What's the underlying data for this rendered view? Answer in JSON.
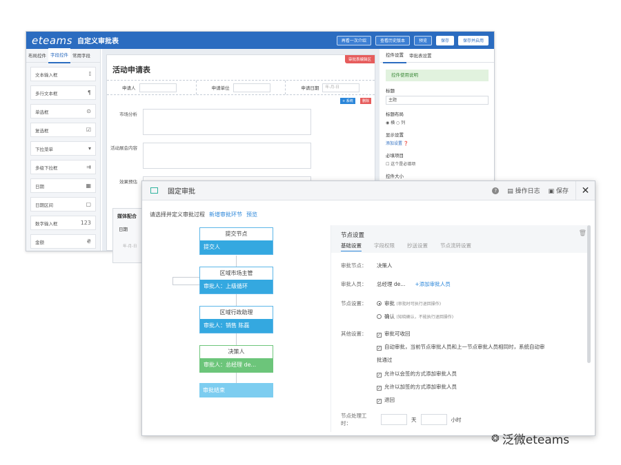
{
  "back": {
    "logo": "eteams",
    "title": "自定义审批表",
    "buttons": [
      "再看一次介绍",
      "查看历史版本",
      "预览",
      "保存",
      "保存并启用"
    ],
    "left_tabs": [
      "布局控件",
      "字段控件",
      "常用字段"
    ],
    "controls": [
      {
        "label": "文本输入框",
        "icon": "𝕀"
      },
      {
        "label": "多行文本框",
        "icon": "¶"
      },
      {
        "label": "单选框",
        "icon": "⊙"
      },
      {
        "label": "复选框",
        "icon": "☑"
      },
      {
        "label": "下拉菜单",
        "icon": "▾"
      },
      {
        "label": "多级下拉框",
        "icon": "⇉"
      },
      {
        "label": "日期",
        "icon": "▦"
      },
      {
        "label": "日期区间",
        "icon": "▢"
      },
      {
        "label": "数字输入框",
        "icon": "123"
      },
      {
        "label": "金额",
        "icon": "₴"
      }
    ],
    "form_title": "活动申请表",
    "red_tag": "审批表编辑区",
    "row1": [
      {
        "label": "申请人",
        "value": ""
      },
      {
        "label": "申请单位",
        "value": ""
      },
      {
        "label": "申请日期",
        "value": "年-月-日"
      }
    ],
    "fields": [
      "市场分析",
      "活动展会内容",
      "效果预估"
    ],
    "media_label": "媒体配合",
    "date_label": "日期",
    "date_placeholder": "年-月-日",
    "chip_add": "+ 系统",
    "chip_del": "删除",
    "right_tabs": [
      "控件设置",
      "审批表设置"
    ],
    "green_bar": "控件使用说明",
    "title_label": "标题",
    "title_value": "主题",
    "layout_label": "标题布局",
    "layout_options": "◉ 横  ○ 列",
    "display_label": "显示设置",
    "display_link": "添加设置 ❓",
    "required_label": "必填项目",
    "required_text": "☐ 这个是必填项",
    "size_label": "控件大小"
  },
  "front": {
    "title": "固定审批",
    "log_label": "操作日志",
    "save_label": "保存",
    "instruction": "请选择并定义审批过程",
    "add_link": "新增审批环节",
    "preview_link": "预览",
    "nodes": [
      {
        "top": "提交节点",
        "bottom": "提交人"
      },
      {
        "top": "区域市场主管",
        "bottom": "审批人：上级循环"
      },
      {
        "top": "区域行政助理",
        "bottom": "审批人：销售 陈磊"
      },
      {
        "top": "决策人",
        "bottom": "审批人：总经理 de..."
      }
    ],
    "end_node": "审批结束",
    "settings": {
      "title": "节点设置",
      "tabs": [
        "基础设置",
        "字段权限",
        "抄送设置",
        "节点流转设置"
      ],
      "node_key": "审批节点：",
      "node_val": "决策人",
      "approver_key": "审批人员：",
      "approver_val": "总经理 de...",
      "add_approver": "+添加审批人员",
      "setting_key": "节点设置：",
      "opt1": "审批",
      "opt1_note": "(审批时可执行退回操作)",
      "opt2": "确认",
      "opt2_note": "(知晓确认，不能执行退回操作)",
      "other_key": "其他设置：",
      "others": [
        "审批可收回",
        "自动审批，当前节点审批人员和上一节点审批人员相同时，系统自动审",
        "批通过",
        "允许以会签的方式添加审批人员",
        "允许以加签的方式添加审批人员",
        "退回"
      ],
      "time_key": "节点处理工时：",
      "day": "天",
      "hour": "小时"
    }
  },
  "watermark": "泛微eteams"
}
